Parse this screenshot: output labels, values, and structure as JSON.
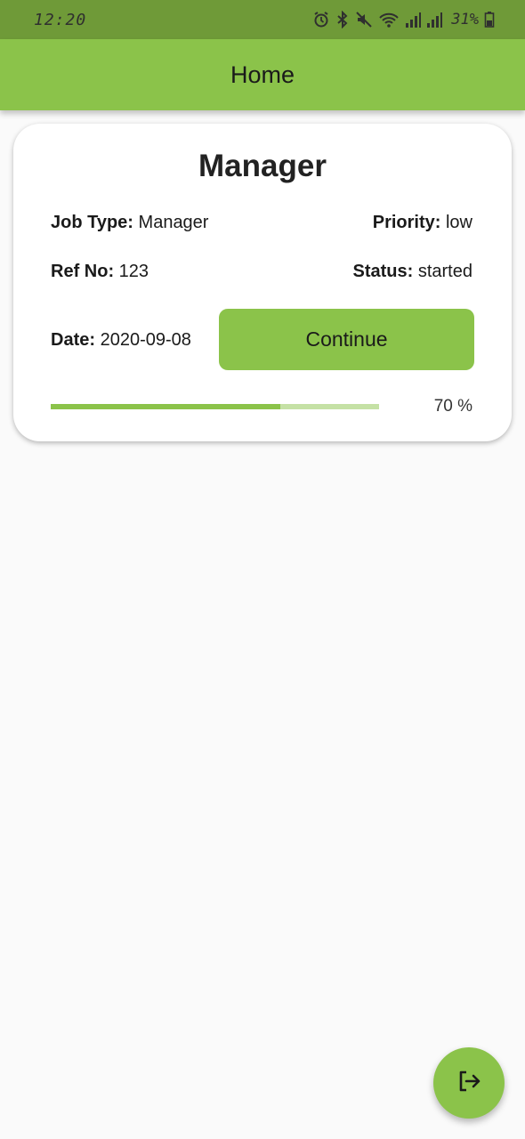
{
  "status_bar": {
    "time": "12:20",
    "battery": "31%"
  },
  "app_bar": {
    "title": "Home"
  },
  "job_card": {
    "title": "Manager",
    "job_type_label": "Job Type:",
    "job_type_value": "Manager",
    "priority_label": "Priority:",
    "priority_value": "low",
    "ref_label": "Ref No:",
    "ref_value": "123",
    "status_label": "Status:",
    "status_value": "started",
    "date_label": "Date:",
    "date_value": "2020-09-08",
    "continue_label": "Continue",
    "progress": 0.7,
    "progress_text": "70 %"
  },
  "fab": {
    "icon": "logout-icon"
  },
  "colors": {
    "primary": "#8bc34a",
    "status_bar": "#6f9a38",
    "progress_track": "#c5e1a5",
    "background": "#fafafa"
  }
}
